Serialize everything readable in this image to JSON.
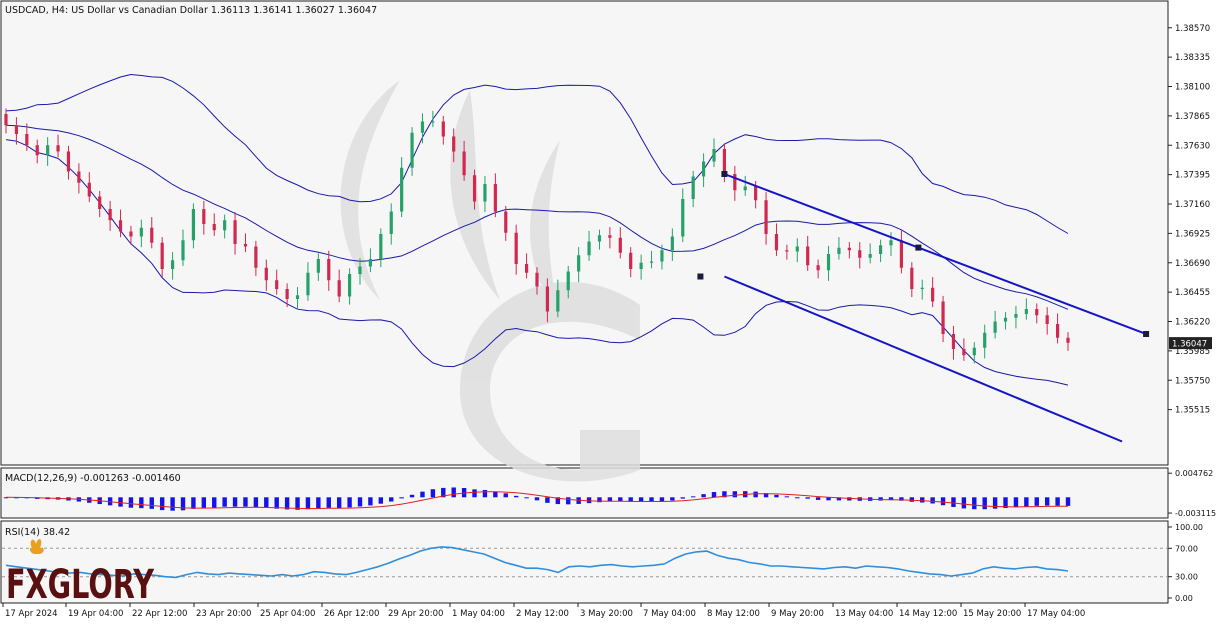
{
  "header": {
    "symbol_line": "USDCAD, H4:  US Dollar vs Canadian Dollar  1.36113 1.36141 1.36027 1.36047"
  },
  "logo": {
    "text": "FXGLORY"
  },
  "colors": {
    "bull": "#26a269",
    "bear": "#d0284f",
    "bands": "#1a1aa8",
    "channel": "#1414c8",
    "macd_hist": "#1414e6",
    "macd_signal": "#e02020",
    "rsi": "#2f8fdc"
  },
  "chart_data": [
    {
      "type": "candlestick",
      "title": "USDCAD, H4:  US Dollar vs Canadian Dollar  1.36113 1.36141 1.36027 1.36047",
      "y_ticks": [
        "1.38570",
        "1.38335",
        "1.38100",
        "1.37865",
        "1.37630",
        "1.37395",
        "1.37160",
        "1.36925",
        "1.36690",
        "1.36455",
        "1.36220",
        "1.35985",
        "1.35750",
        "1.35515"
      ],
      "ylim": [
        1.3532,
        1.3868
      ],
      "current_price": "1.36047",
      "x_ticks": [
        "17 Apr 2024",
        "19 Apr 04:00",
        "22 Apr 12:00",
        "23 Apr 20:00",
        "25 Apr 04:00",
        "26 Apr 12:00",
        "29 Apr 20:00",
        "1 May 04:00",
        "2 May 12:00",
        "3 May 20:00",
        "7 May 04:00",
        "8 May 12:00",
        "9 May 20:00",
        "13 May 04:00",
        "14 May 12:00",
        "15 May 20:00",
        "17 May 04:00"
      ],
      "close_path": [
        1.3779,
        1.3772,
        1.3763,
        1.3755,
        1.3763,
        1.3758,
        1.3742,
        1.3733,
        1.3722,
        1.3712,
        1.3703,
        1.3694,
        1.369,
        1.3697,
        1.3685,
        1.3664,
        1.3671,
        1.3687,
        1.3712,
        1.37,
        1.3695,
        1.3703,
        1.3684,
        1.3682,
        1.3665,
        1.3655,
        1.3648,
        1.364,
        1.3643,
        1.3661,
        1.3672,
        1.3655,
        1.3642,
        1.366,
        1.3666,
        1.3672,
        1.3692,
        1.371,
        1.3745,
        1.3773,
        1.3782,
        1.3782,
        1.377,
        1.3758,
        1.3739,
        1.3718,
        1.3732,
        1.371,
        1.3693,
        1.3668,
        1.3661,
        1.365,
        1.363,
        1.3647,
        1.3662,
        1.3675,
        1.3686,
        1.3691,
        1.3689,
        1.3677,
        1.3664,
        1.3669,
        1.367,
        1.3679,
        1.369,
        1.372,
        1.3738,
        1.375,
        1.376,
        1.374,
        1.3727,
        1.373,
        1.3719,
        1.3692,
        1.3679,
        1.3678,
        1.3682,
        1.3667,
        1.3663,
        1.3676,
        1.3681,
        1.3679,
        1.3673,
        1.3676,
        1.3683,
        1.3687,
        1.3665,
        1.3648,
        1.3649,
        1.3638,
        1.3612,
        1.36,
        1.3595,
        1.3601,
        1.3613,
        1.3622,
        1.3625,
        1.3628,
        1.3632,
        1.3627,
        1.362,
        1.3609,
        1.3605
      ]
    },
    {
      "type": "bar",
      "title": "MACD(12,26,9) -0.001263 -0.001460",
      "y_ticks": [
        "0.004762",
        "-0.003115"
      ],
      "ylim": [
        -0.0035,
        0.0052
      ]
    },
    {
      "type": "line",
      "title": "RSI(14) 38.42",
      "y_ticks": [
        "100.00",
        "70.00",
        "30.00",
        "0.00"
      ],
      "ylim": [
        0,
        100
      ],
      "levels": [
        30,
        70
      ],
      "values": [
        46,
        44,
        42,
        40,
        38,
        36,
        35,
        36,
        34,
        33,
        32,
        31,
        34,
        33,
        32,
        30,
        29,
        33,
        36,
        34,
        33,
        35,
        34,
        33,
        32,
        31,
        33,
        31,
        33,
        37,
        36,
        34,
        33,
        36,
        40,
        44,
        49,
        55,
        60,
        66,
        70,
        72,
        71,
        68,
        65,
        62,
        56,
        50,
        46,
        42,
        42,
        40,
        36,
        44,
        45,
        44,
        46,
        47,
        45,
        44,
        45,
        46,
        48,
        56,
        62,
        65,
        66,
        60,
        56,
        54,
        50,
        48,
        45,
        45,
        44,
        43,
        42,
        41,
        43,
        44,
        42,
        45,
        44,
        43,
        41,
        38,
        36,
        34,
        33,
        31,
        33,
        35,
        41,
        44,
        42,
        41,
        43,
        44,
        41,
        40,
        38
      ]
    }
  ]
}
